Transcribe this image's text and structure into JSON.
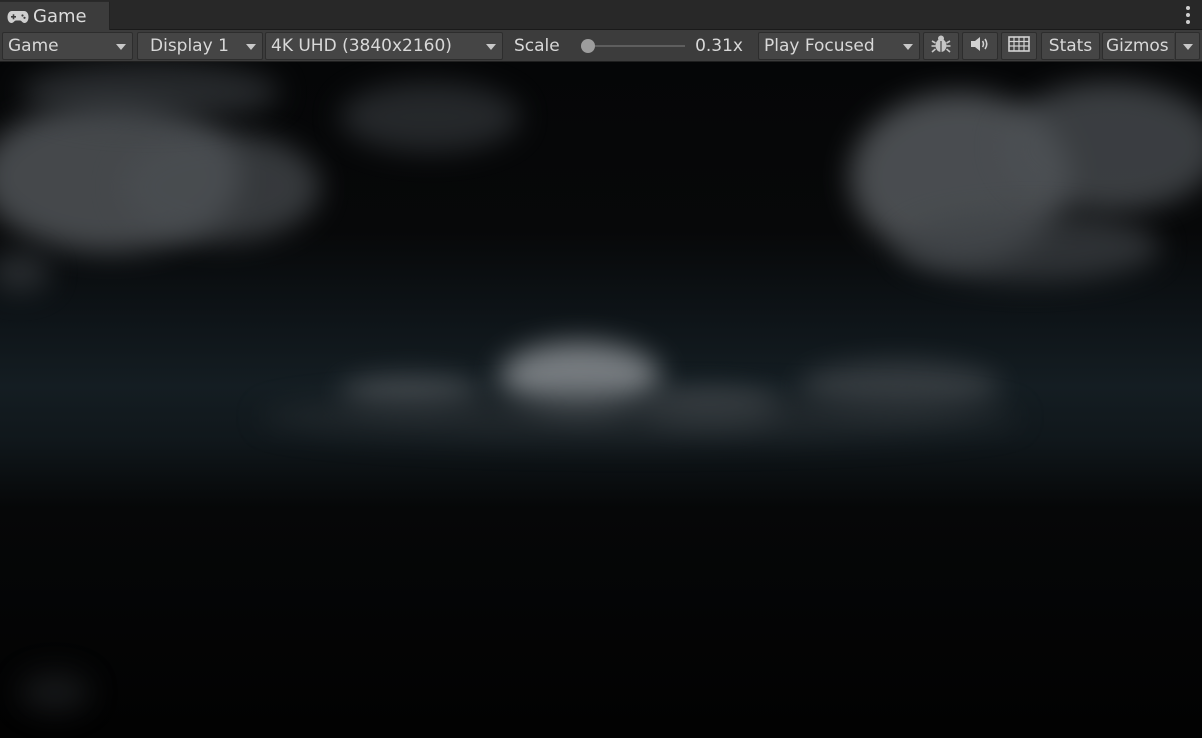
{
  "tab": {
    "title": "Game",
    "icon": "gamepad-icon"
  },
  "menu": {
    "icon": "kebab-menu-icon"
  },
  "toolbar": {
    "mode_label": "Game",
    "display_label": "Display 1",
    "resolution_label": "4K UHD (3840x2160)",
    "scale_label": "Scale",
    "scale_value": "0.31x",
    "scale_fraction": 0.0,
    "play_mode_label": "Play Focused",
    "bug_icon": "bug-icon",
    "audio_icon": "speaker-icon",
    "keyboard_icon": "keyboard-icon",
    "stats_label": "Stats",
    "gizmos_label": "Gizmos"
  },
  "colors": {
    "toolbar_bg": "#3c3c3c",
    "tab_bg": "#3c3c3c",
    "text": "#d8d8d8",
    "viewport_sky": "#0e1418"
  }
}
